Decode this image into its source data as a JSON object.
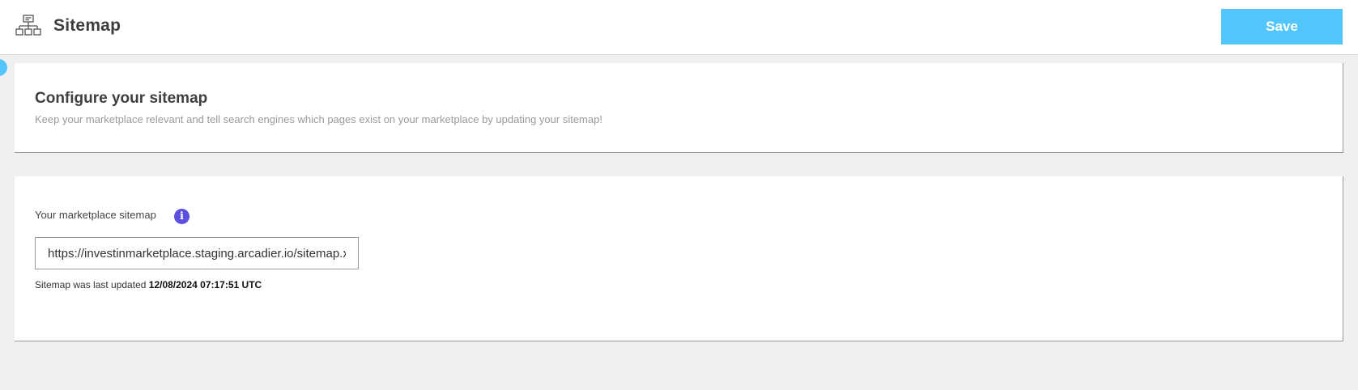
{
  "header": {
    "title": "Sitemap",
    "icon": "sitemap-icon",
    "save_label": "Save"
  },
  "intro": {
    "title": "Configure your sitemap",
    "description": "Keep your marketplace relevant and tell search engines which pages exist on your marketplace by updating your sitemap!"
  },
  "sitemap": {
    "label": "Your marketplace sitemap",
    "info_icon": "info-icon",
    "url_value": "https://investinmarketplace.staging.arcadier.io/sitemap.xml",
    "last_updated_prefix": "Sitemap was last updated",
    "last_updated_value": "12/08/2024 07:17:51 UTC"
  },
  "colors": {
    "accent": "#52c6fb",
    "info": "#5b4fe0",
    "background": "#f0f0f0"
  }
}
